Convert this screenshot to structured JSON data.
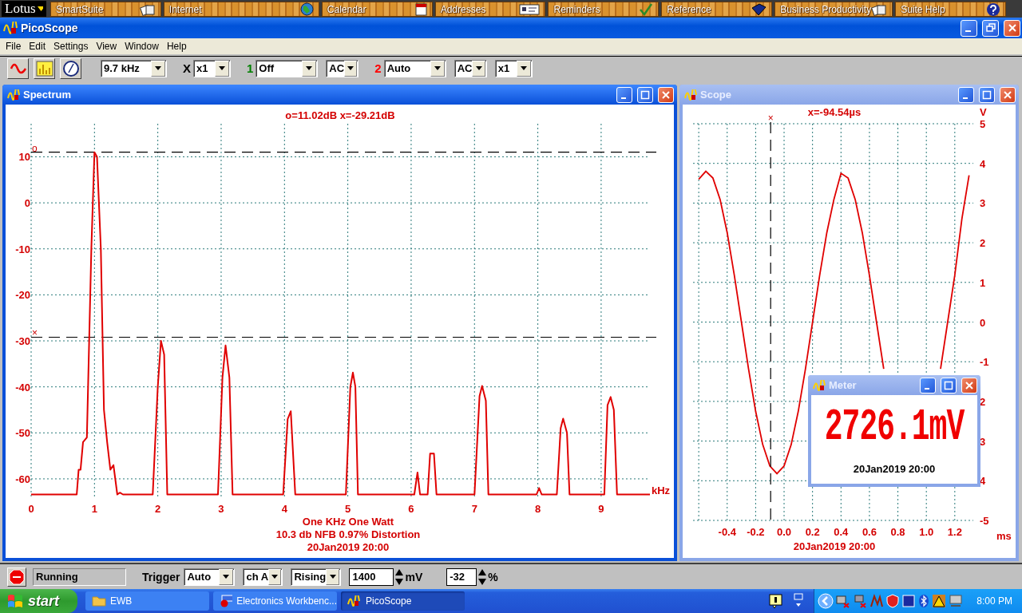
{
  "lotus_bar": {
    "menu": "Lotus",
    "items": [
      {
        "label": "SmartSuite"
      },
      {
        "label": "Internet"
      },
      {
        "label": "Calendar"
      },
      {
        "label": "Addresses"
      },
      {
        "label": "Reminders"
      },
      {
        "label": "Reference"
      },
      {
        "label": "Business Productivity"
      },
      {
        "label": "Suite Help"
      }
    ]
  },
  "window": {
    "title": "PicoScope"
  },
  "menu": [
    "File",
    "Edit",
    "Settings",
    "View",
    "Window",
    "Help"
  ],
  "toolbar": {
    "items": [
      {
        "kind": "select",
        "value": "9.7 kHz"
      },
      {
        "kind": "label",
        "text": "X",
        "color": "#000000"
      },
      {
        "kind": "select",
        "value": "x1"
      },
      {
        "kind": "label",
        "text": "1",
        "color": "#008000"
      },
      {
        "kind": "select",
        "value": "Off"
      },
      {
        "kind": "select",
        "value": "AC"
      },
      {
        "kind": "label",
        "text": "2",
        "color": "#ff0000"
      },
      {
        "kind": "select",
        "value": "Auto"
      },
      {
        "kind": "select",
        "value": "AC"
      },
      {
        "kind": "select",
        "value": "x1"
      }
    ]
  },
  "spectrum": {
    "title": "Spectrum",
    "active": true,
    "readout": "o=11.02dB  x=-29.21dB",
    "chart_data": {
      "type": "line",
      "xlabel": "kHz",
      "xlim": [
        0,
        9.77
      ],
      "ylim": [
        -64,
        17.2
      ],
      "xticks": [
        0,
        1,
        2,
        3,
        4,
        5,
        6,
        7,
        8,
        9
      ],
      "yticks": [
        10,
        0,
        -10,
        -20,
        -30,
        -40,
        -50,
        -60
      ],
      "x": [
        0,
        0.72,
        0.75,
        0.78,
        0.82,
        0.88,
        0.95,
        1.0,
        1.04,
        1.1,
        1.15,
        1.2,
        1.25,
        1.3,
        1.36,
        1.4,
        1.45,
        1.92,
        2.0,
        2.05,
        2.1,
        2.15,
        2.95,
        3.02,
        3.07,
        3.13,
        3.18,
        3.98,
        4.05,
        4.1,
        4.17,
        4.97,
        5.04,
        5.08,
        5.12,
        5.16,
        6.05,
        6.1,
        6.14,
        6.26,
        6.3,
        6.36,
        6.4,
        7.0,
        7.08,
        7.12,
        7.18,
        7.22,
        7.98,
        8.02,
        8.06,
        8.3,
        8.36,
        8.4,
        8.46,
        8.5,
        9.05,
        9.1,
        9.15,
        9.2,
        9.25,
        9.77
      ],
      "series": [
        {
          "color": "#e00000",
          "values": [
            -63.4,
            -63.4,
            -58,
            -58,
            -52,
            -51,
            -10,
            11,
            10,
            -10,
            -45,
            -52,
            -58,
            -57,
            -63.4,
            -63,
            -63.4,
            -63.4,
            -40,
            -30,
            -33,
            -63.4,
            -63.4,
            -38,
            -31,
            -38,
            -63.4,
            -63.4,
            -47,
            -45.3,
            -63.4,
            -63.4,
            -40,
            -36.9,
            -40,
            -63.4,
            -63.4,
            -58.6,
            -63.4,
            -63.4,
            -54.5,
            -54.5,
            -63.4,
            -63.4,
            -42,
            -39.8,
            -43,
            -63.4,
            -63.4,
            -62,
            -63.4,
            -63.4,
            -49,
            -46.9,
            -50,
            -63.4,
            -63.4,
            -44,
            -42.2,
            -45,
            -63.4,
            -63.4
          ]
        }
      ],
      "grid": true,
      "ref_lines": [
        {
          "axis": "y",
          "value": 11.02,
          "label": "o"
        },
        {
          "axis": "y",
          "value": -29.21,
          "label": "×"
        }
      ]
    },
    "notes": [
      "One KHz One Watt",
      "10.3 db NFB 0.97% Distortion",
      "20Jan2019  20:00"
    ]
  },
  "scope": {
    "title": "Scope",
    "active": false,
    "readout": "x=-94.54µs",
    "chart_data": {
      "type": "line",
      "xlabel": "ms",
      "ylabel": "V",
      "xlim": [
        -0.64,
        1.33
      ],
      "ylim": [
        -5,
        5
      ],
      "xticks": [
        -0.4,
        -0.2,
        {
          "value": 0,
          "label": "0.0"
        },
        0.2,
        0.4,
        0.6,
        0.8,
        {
          "value": 1,
          "label": "1.0"
        },
        1.2
      ],
      "yticks": [
        5,
        4,
        3,
        2,
        1,
        0,
        -1,
        {
          "value": -2,
          "label": "2"
        },
        {
          "value": -3,
          "label": "3"
        },
        {
          "value": -4,
          "label": "4"
        },
        -5
      ],
      "x": [
        -0.6,
        -0.55,
        -0.5,
        -0.45,
        -0.4,
        -0.35,
        -0.3,
        -0.25,
        -0.2,
        -0.15,
        -0.1,
        -0.05,
        0,
        0.05,
        0.1,
        0.15,
        0.2,
        0.25,
        0.3,
        0.35,
        0.4,
        0.45,
        0.5,
        0.55,
        0.6,
        0.65,
        0.7,
        0.75,
        0.8,
        0.85,
        0.9,
        0.95,
        1.0,
        1.05,
        1.1,
        1.15,
        1.2,
        1.25,
        1.3
      ],
      "series": [
        {
          "color": "#e00000",
          "values": [
            3.6,
            3.8,
            3.63,
            3.09,
            2.25,
            1.18,
            0,
            -1.18,
            -2.25,
            -3.09,
            -3.63,
            -3.82,
            -3.63,
            -3.09,
            -2.25,
            -1.18,
            0,
            1.18,
            2.25,
            3.09,
            3.75,
            3.63,
            3.09,
            2.25,
            1.18,
            0,
            -1.18,
            null,
            null,
            null,
            null,
            null,
            null,
            null,
            -1.18,
            0,
            1.18,
            2.6,
            3.7
          ]
        }
      ],
      "grid": true,
      "ref_lines": [
        {
          "axis": "x",
          "value": -0.0945,
          "label": "×"
        }
      ]
    },
    "timestamp": "20Jan2019  20:00"
  },
  "meter": {
    "title": "Meter",
    "active": false,
    "reading": "2726.1mV",
    "timestamp": "20Jan2019  20:00"
  },
  "status_bar": {
    "state": "Running",
    "trigger_label": "Trigger",
    "trigger_mode": "Auto",
    "channel": "ch A",
    "edge": "Rising",
    "threshold": "1400",
    "threshold_unit": "mV",
    "delay": "-32",
    "delay_unit": "%"
  },
  "taskbar": {
    "start": "start",
    "tasks": [
      {
        "label": "EWB",
        "selected": false
      },
      {
        "label": "Electronics Workbenc...",
        "selected": false
      },
      {
        "label": "PicoScope",
        "selected": true
      }
    ],
    "clock": "8:00 PM"
  }
}
